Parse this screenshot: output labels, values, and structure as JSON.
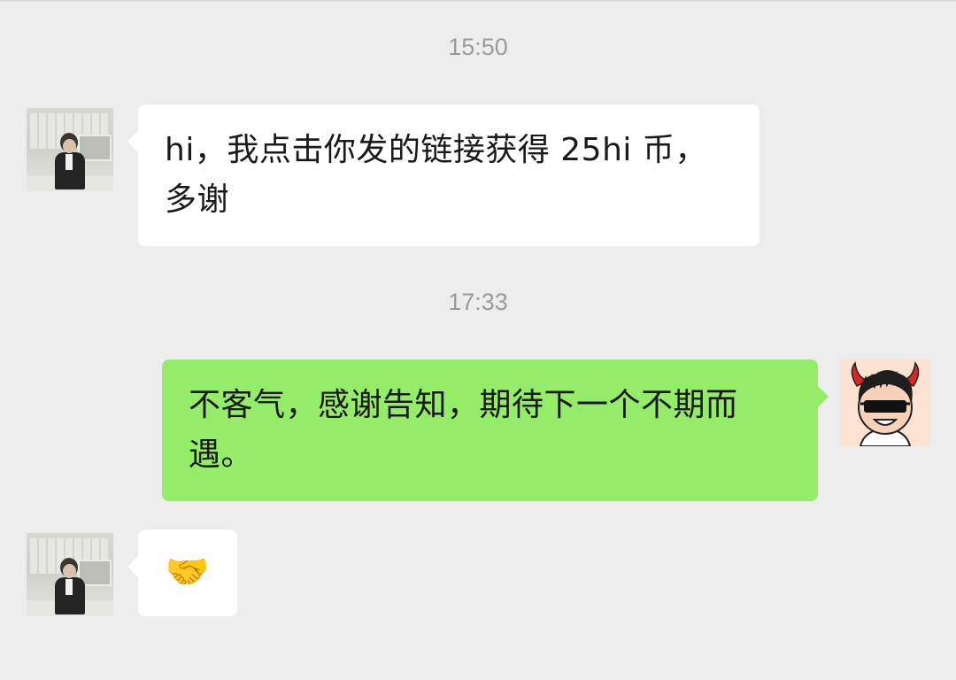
{
  "chat": {
    "messages": [
      {
        "time": "15:50",
        "sender": "other",
        "text": "hi，我点击你发的链接获得 25hi 币，多谢"
      },
      {
        "time": "17:33",
        "sender": "me",
        "text": "不客气，感谢告知，期待下一个不期而遇。"
      },
      {
        "sender": "other",
        "text": "🤝"
      }
    ]
  },
  "icons": {
    "other_avatar": "person-photo-avatar-icon",
    "my_avatar": "devil-sunglasses-avatar-icon",
    "handshake": "handshake-emoji-icon"
  },
  "colors": {
    "background": "#ededed",
    "received_bubble": "#ffffff",
    "sent_bubble": "#95ec69",
    "timestamp": "#9b9b9b"
  }
}
